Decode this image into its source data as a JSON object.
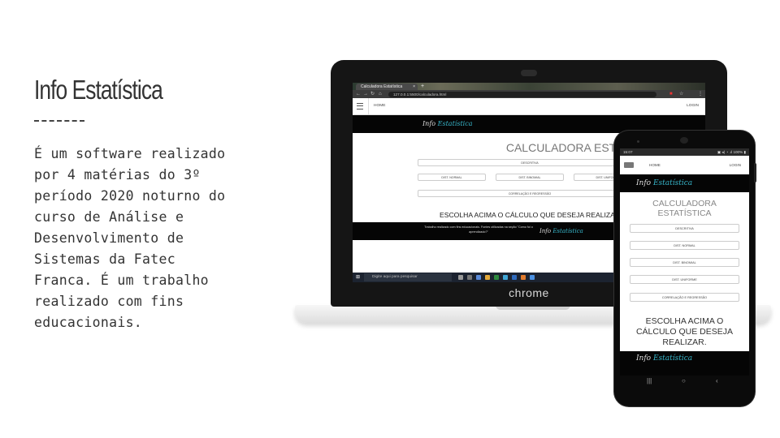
{
  "slide": {
    "title": "Info Estatística",
    "body_lines": [
      "É um software realizado",
      "por 4 matérias do 3º",
      "período 2020 noturno do",
      "curso de Análise e",
      "Desenvolvimento de",
      "Sistemas da Fatec",
      "Franca. É um trabalho",
      "realizado com fins",
      "educacionais."
    ]
  },
  "laptop": {
    "brand": "chrome",
    "browser": {
      "tab_title": "Calculadora Estatística",
      "tab_close": "×",
      "new_tab": "+",
      "url": "127.0.0.1:5500/calculadora.html"
    },
    "site": {
      "nav_home": "HOME",
      "nav_login": "LOGIN",
      "logo_info": "Info ",
      "logo_estatistica": "Estatística",
      "title": "CALCULADORA ESTATÍSTICA",
      "buttons": {
        "descritiva": "DESCRITIVA",
        "normal": "DIST. NORMAL",
        "binomial": "DIST. BINOMIAL",
        "uniforme": "DIST. UNIFORME",
        "correlacao": "CORRELAÇÃO E REGRESSÃO"
      },
      "choose_text": "ESCOLHA ACIMA O CÁLCULO QUE DESEJA REALIZAR.",
      "footer_text": "Trabalho realizado com fins educacionais. Fontes utilizadas na seção \"Como foi o aprendizado?\"",
      "footer_logo_info": "Info ",
      "footer_logo_estatistica": "Estatística"
    },
    "taskbar": {
      "search_placeholder": "Digite aqui para pesquisar"
    }
  },
  "phone": {
    "status_time": "15:07",
    "status_right": "▣ ◂) ◔ .ıl 100% ▮",
    "nav_home": "HOME",
    "nav_login": "LOGIN",
    "logo_info": "Info ",
    "logo_estatistica": "Estatística",
    "title_line1": "CALCULADORA",
    "title_line2": "ESTATÍSTICA",
    "buttons": {
      "descritiva": "DESCRITIVA",
      "normal": "DIST. NORMAL",
      "binomial": "DIST. BINOMIAL",
      "uniforme": "DIST. UNIFORME",
      "correlacao": "CORRELAÇÃO E REGRESSÃO"
    },
    "choose_line1": "ESCOLHA ACIMA O",
    "choose_line2": "CÁLCULO QUE DESEJA",
    "choose_line3": "REALIZAR.",
    "footer_logo_info": "Info ",
    "footer_logo_estatistica": "Estatística",
    "nav_buttons": {
      "recents": "|||",
      "home": "○",
      "back": "‹"
    }
  },
  "colors": {
    "accent": "#37b5c9",
    "text": "#333333",
    "device": "#151515"
  }
}
